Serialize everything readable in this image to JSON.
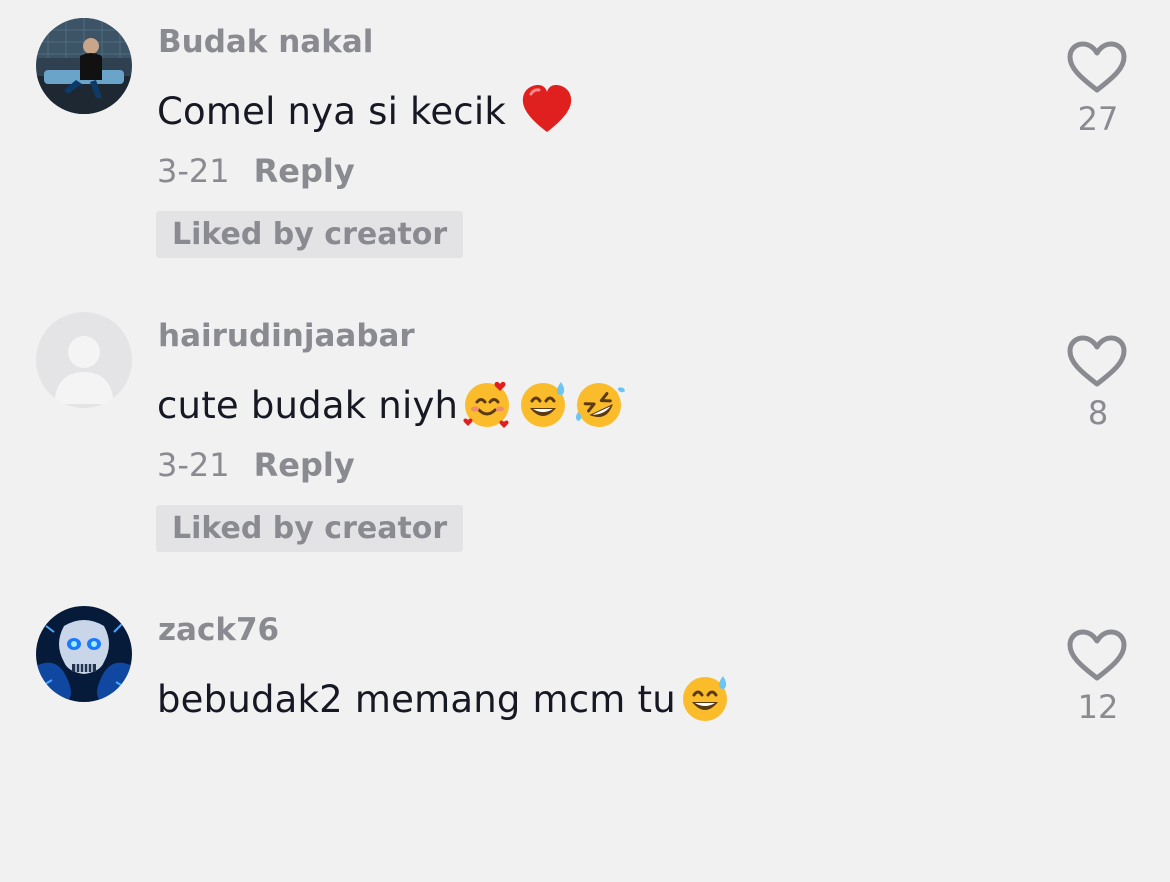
{
  "comments": [
    {
      "username": "Budak nakal",
      "text": "Comel nya si kecik ",
      "emojis": [
        "red-heart"
      ],
      "date": "3-21",
      "reply_label": "Reply",
      "liked_by_creator": "Liked by creator",
      "likes": "27"
    },
    {
      "username": "hairudinjaabar",
      "text": "cute budak niyh",
      "emojis": [
        "smiling-face-with-hearts",
        "grinning-face-with-sweat",
        "rolling-on-floor-laughing"
      ],
      "date": "3-21",
      "reply_label": "Reply",
      "liked_by_creator": "Liked by creator",
      "likes": "8"
    },
    {
      "username": "zack76",
      "text": "bebudak2 memang mcm tu",
      "emojis": [
        "grinning-face-with-sweat"
      ],
      "date": "",
      "reply_label": "",
      "liked_by_creator": "",
      "likes": "12"
    }
  ],
  "colors": {
    "background": "#f1f1f2",
    "username": "#8a8b91",
    "text": "#161823",
    "badge_bg": "#e3e3e5"
  }
}
